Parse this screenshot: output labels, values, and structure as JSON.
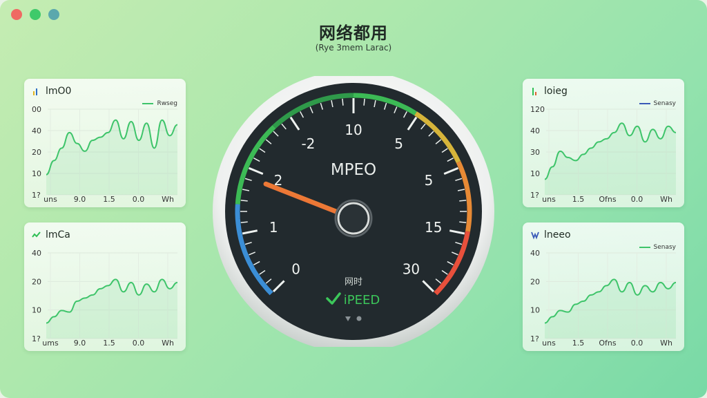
{
  "window": {
    "title": "网络都用",
    "subtitle": "(Rye 3mem Larac)"
  },
  "panels": [
    {
      "id": "tl",
      "title": "lmO0",
      "legend": "Rwseg",
      "yticks": [
        "00",
        "40",
        "20",
        "10",
        "1?"
      ],
      "xticks": [
        "uns",
        "9.0",
        "1.5",
        "0.0",
        "Wh"
      ],
      "color": "#3ec46a",
      "values": [
        13,
        22,
        30,
        40,
        33,
        28,
        35,
        37,
        40,
        48,
        36,
        47,
        35,
        46,
        30,
        48,
        38,
        45
      ]
    },
    {
      "id": "bl",
      "title": "lmCa",
      "legend": "",
      "yticks": [
        "40",
        "20",
        "10",
        "1?"
      ],
      "xticks": [
        "ums",
        "9.0",
        "1.5",
        "0.0",
        "Wh"
      ],
      "color": "#3ec46a",
      "values": [
        10,
        14,
        18,
        17,
        24,
        26,
        28,
        32,
        34,
        38,
        30,
        36,
        28,
        35,
        30,
        38,
        32,
        36
      ]
    },
    {
      "id": "tr",
      "title": "loieg",
      "legend": "Senasy",
      "yticks": [
        "120",
        "40",
        "30",
        "10",
        "1?"
      ],
      "xticks": [
        "uns",
        "1.5",
        "Ofns",
        "0.0",
        "Wh"
      ],
      "color": "#3ec46a",
      "values": [
        10,
        18,
        28,
        24,
        22,
        26,
        30,
        34,
        36,
        40,
        46,
        38,
        44,
        34,
        42,
        36,
        44,
        40
      ]
    },
    {
      "id": "br",
      "title": "lneeo",
      "legend": "Senasy",
      "yticks": [
        "40",
        "20",
        "10",
        "1?"
      ],
      "xticks": [
        "uns",
        "1.5",
        "Ofns",
        "0.0",
        "Wh"
      ],
      "color": "#3ec46a",
      "values": [
        10,
        14,
        18,
        17,
        22,
        24,
        28,
        30,
        34,
        38,
        30,
        36,
        28,
        34,
        30,
        36,
        32,
        36
      ]
    }
  ],
  "gauge": {
    "center_label": "MPEO",
    "scale_labels": [
      "0",
      "1",
      "2",
      "-2",
      "10",
      "5",
      "5",
      "15",
      "30"
    ],
    "sub_label": "网时",
    "status_text": "iPEED",
    "check_icon": "check-icon",
    "needle_value": 0.42,
    "colors": {
      "blue": "#3b8ed6",
      "green": "#3cba55",
      "yellow": "#d6b43a",
      "orange": "#e88a35",
      "red": "#e8503c",
      "face": "#222a2e"
    }
  }
}
